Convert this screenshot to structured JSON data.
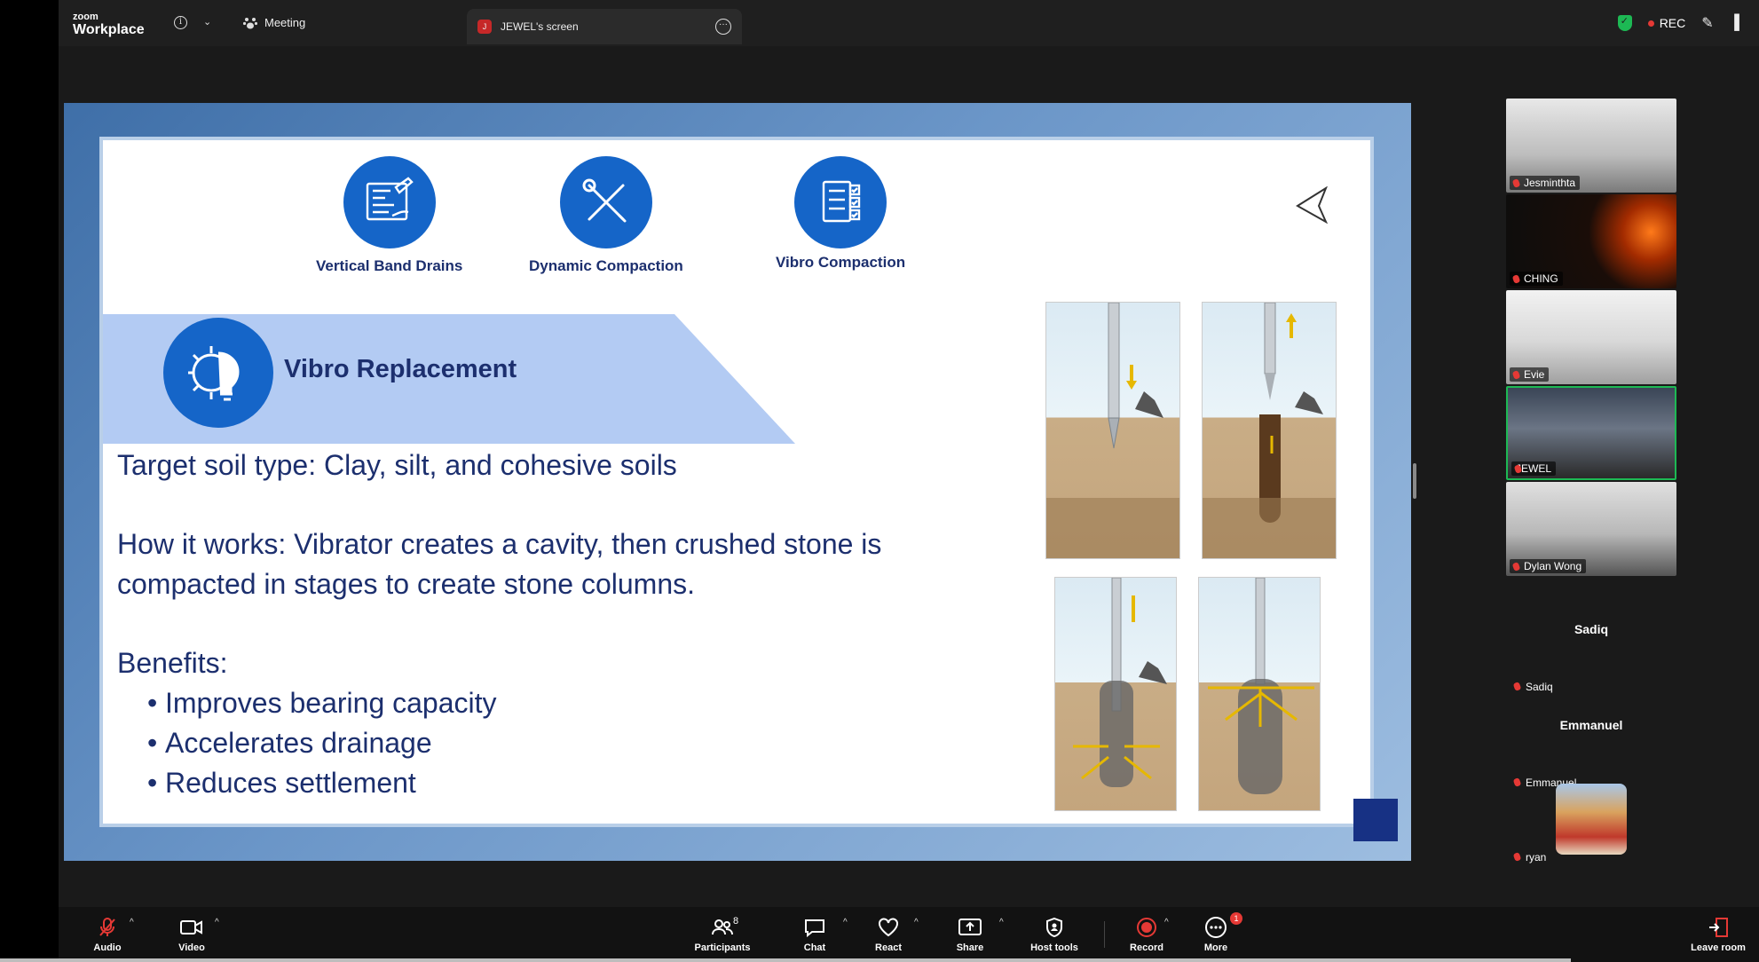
{
  "topbar": {
    "brand_small": "zoom",
    "brand_large": "Workplace",
    "meeting_label": "Meeting",
    "screen_tab_badge": "J",
    "screen_tab_label": "JEWEL's screen",
    "rec_label": "REC"
  },
  "slide": {
    "top_icons": [
      {
        "label": "Vertical Band Drains",
        "icon": "blueprint-icon"
      },
      {
        "label": "Dynamic Compaction",
        "icon": "tools-icon"
      },
      {
        "label": "Vibro Compaction",
        "icon": "checklist-icon"
      }
    ],
    "banner_title": "Vibro Replacement",
    "target_line": "Target soil type: Clay, silt, and cohesive soils",
    "how_line_1": "How it works: Vibrator creates a cavity, then crushed stone is",
    "how_line_2": "compacted in stages to create stone columns.",
    "benefits_heading": "Benefits:",
    "benefits": [
      "Improves bearing capacity",
      "Accelerates drainage",
      "Reduces settlement"
    ],
    "colors": {
      "navy_text": "#1c2f6e",
      "icon_blue": "#1565c8",
      "banner": "#b3cbf3"
    }
  },
  "participants": {
    "tiles": [
      {
        "name": "Jesminthta"
      },
      {
        "name": "CHING"
      },
      {
        "name": "Evie"
      },
      {
        "name": "JEWEL"
      },
      {
        "name": "Dylan Wong"
      }
    ],
    "name_cards": [
      {
        "display": "Sadiq",
        "name": "Sadiq"
      },
      {
        "display": "Emmanuel",
        "name": "Emmanuel"
      }
    ],
    "avatar_tile": {
      "name": "ryan"
    }
  },
  "toolbar": {
    "audio": "Audio",
    "video": "Video",
    "participants": "Participants",
    "participants_count": "8",
    "chat": "Chat",
    "react": "React",
    "share": "Share",
    "host_tools": "Host tools",
    "record": "Record",
    "more": "More",
    "more_badge": "1",
    "leave": "Leave room"
  }
}
